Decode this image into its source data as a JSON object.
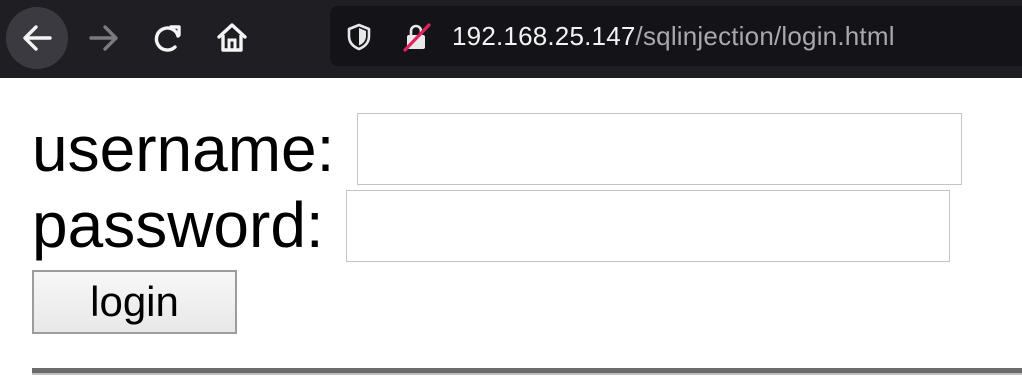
{
  "browser": {
    "url_host": "192.168.25.147",
    "url_path": "/sqlinjection/login.html",
    "icons": {
      "back": "arrow-left-icon",
      "forward": "arrow-right-icon",
      "reload": "reload-icon",
      "home": "home-icon",
      "tracking": "shield-icon",
      "insecure": "insecure-lock-icon"
    },
    "colors": {
      "toolbar": "#1f1e23",
      "url_bar": "#141317",
      "insecure_slash": "#e0245e"
    }
  },
  "form": {
    "username_label": "username:",
    "username_value": "",
    "password_label": "password:",
    "password_value": "",
    "login_label": "login"
  }
}
